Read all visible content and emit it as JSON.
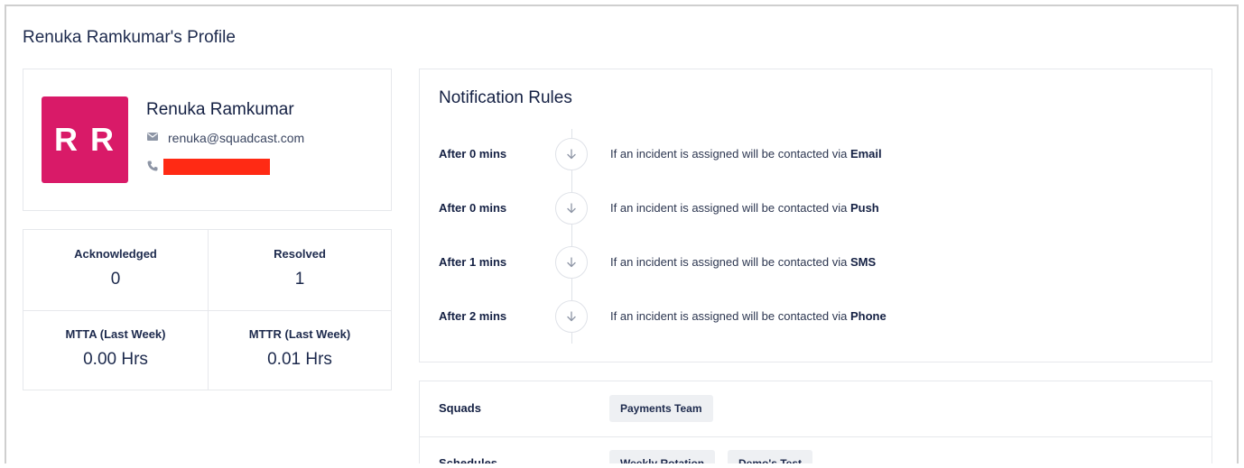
{
  "page": {
    "title": "Renuka Ramkumar's Profile"
  },
  "profile": {
    "initials": "R R",
    "name": "Renuka Ramkumar",
    "email": "renuka@squadcast.com",
    "avatar_color": "#d91a68",
    "redaction_color": "#ff2a14",
    "icons": {
      "email": "envelope-icon",
      "phone": "phone-icon"
    }
  },
  "stats": [
    {
      "label": "Acknowledged",
      "value": "0"
    },
    {
      "label": "Resolved",
      "value": "1"
    },
    {
      "label": "MTTA (Last Week)",
      "value": "0.00 Hrs"
    },
    {
      "label": "MTTR (Last Week)",
      "value": "0.01 Hrs"
    }
  ],
  "notification_rules": {
    "title": "Notification Rules",
    "rule_prefix": "If an incident is assigned will be contacted via",
    "rules": [
      {
        "after": "After 0 mins",
        "channel": "Email"
      },
      {
        "after": "After 0 mins",
        "channel": "Push"
      },
      {
        "after": "After 1 mins",
        "channel": "SMS"
      },
      {
        "after": "After 2 mins",
        "channel": "Phone"
      }
    ],
    "icon": "arrow-down-icon"
  },
  "membership": {
    "squads_label": "Squads",
    "squads": [
      "Payments Team"
    ],
    "schedules_label": "Schedules",
    "schedules": [
      "Weekly Rotation",
      "Demo's Test"
    ]
  }
}
